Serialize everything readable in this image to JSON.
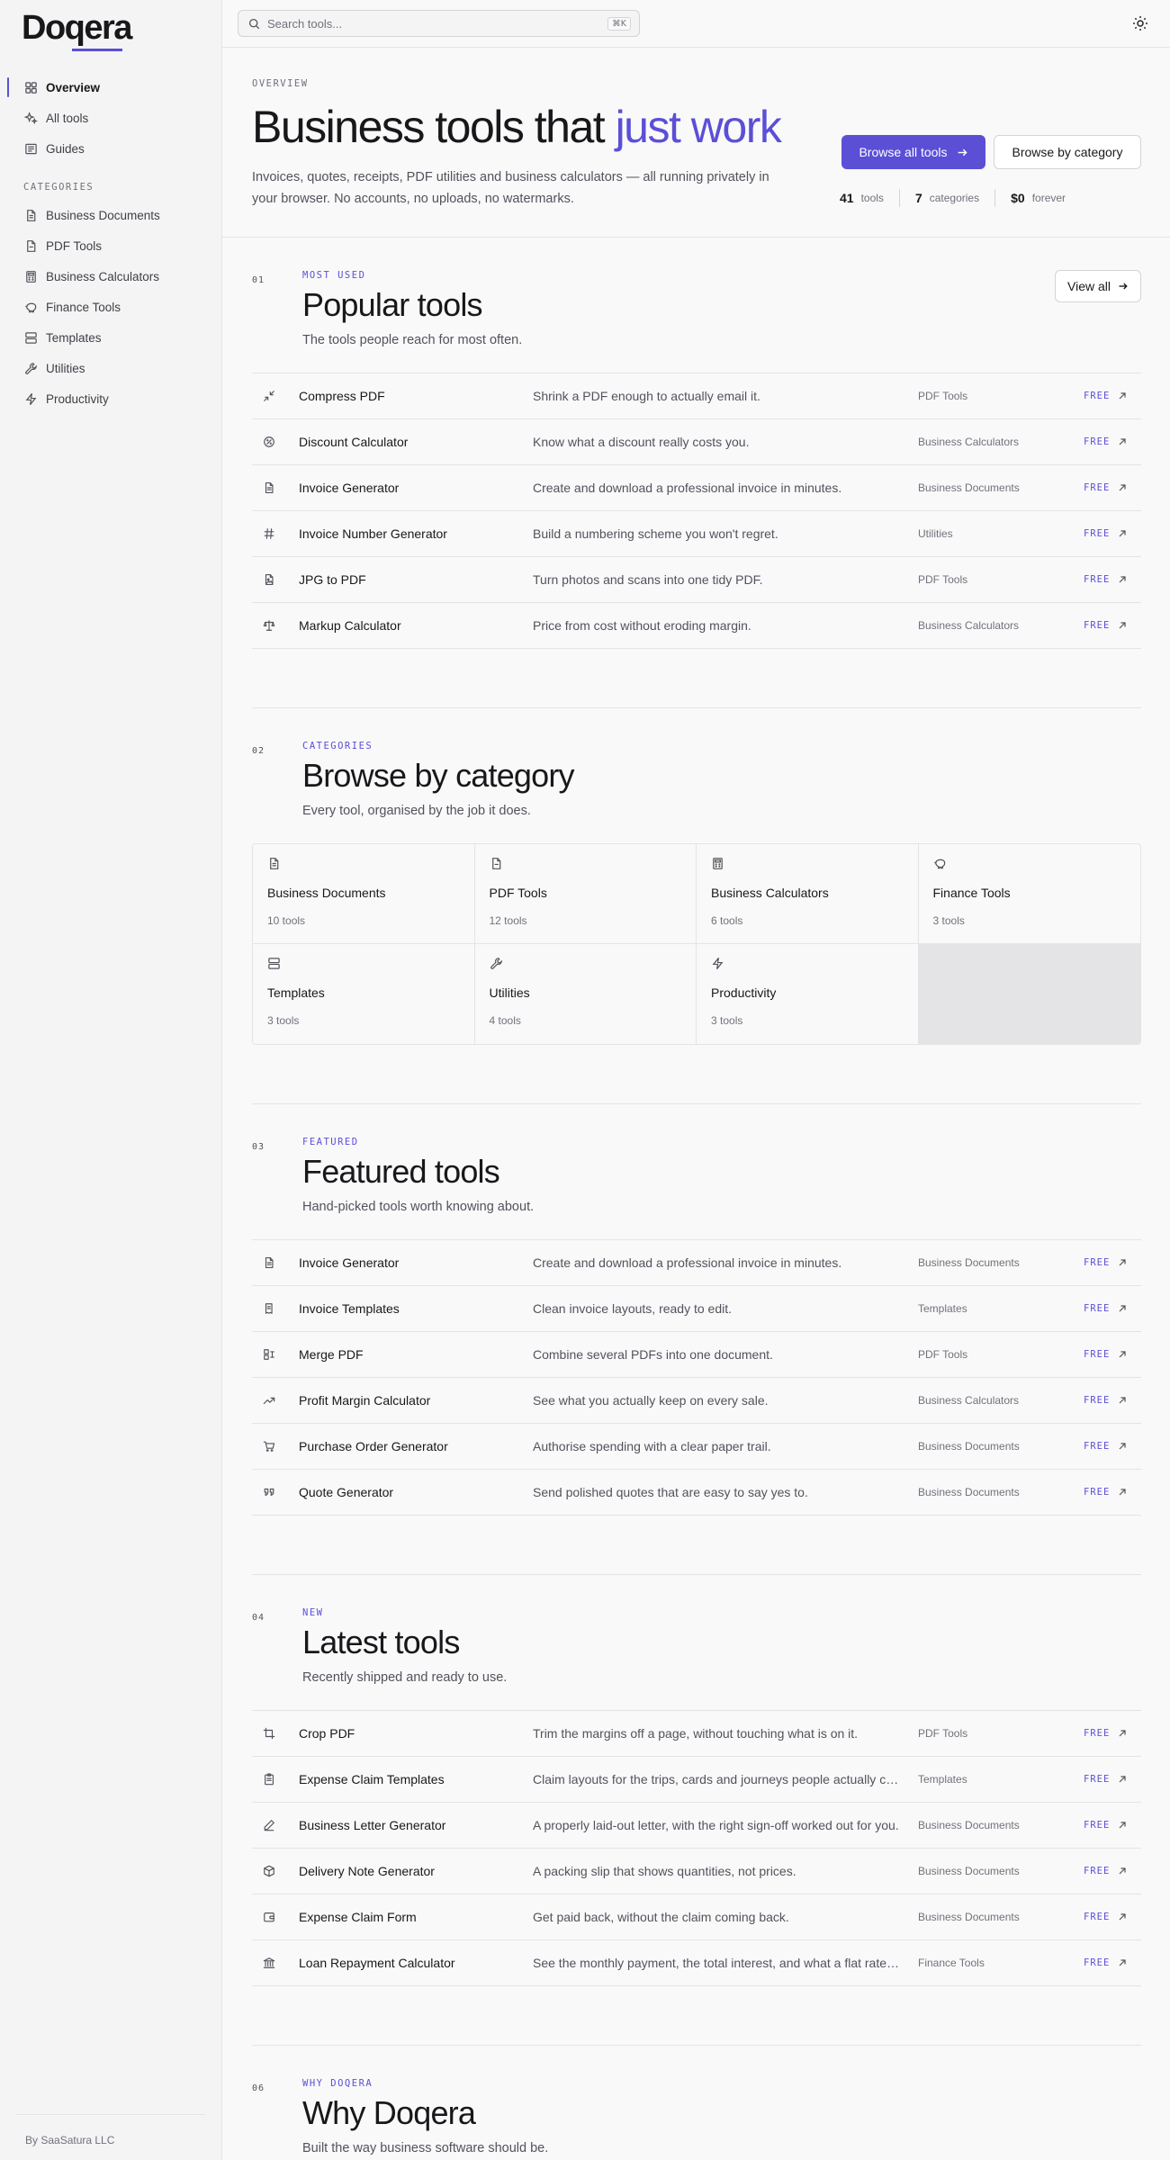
{
  "brand": {
    "logo": "Doqera",
    "footer": "By SaaSatura LLC"
  },
  "sidebar": {
    "items": [
      {
        "label": "Overview",
        "icon": "grid-icon"
      },
      {
        "label": "All tools",
        "icon": "sparkles-icon"
      },
      {
        "label": "Guides",
        "icon": "newspaper-icon"
      }
    ],
    "categories_label": "CATEGORIES",
    "categories": [
      {
        "label": "Business Documents",
        "icon": "document-icon"
      },
      {
        "label": "PDF Tools",
        "icon": "file-icon"
      },
      {
        "label": "Business Calculators",
        "icon": "calculator-icon"
      },
      {
        "label": "Finance Tools",
        "icon": "piggy-bank-icon"
      },
      {
        "label": "Templates",
        "icon": "layout-icon"
      },
      {
        "label": "Utilities",
        "icon": "wrench-icon"
      },
      {
        "label": "Productivity",
        "icon": "zap-icon"
      }
    ]
  },
  "search": {
    "placeholder": "Search tools...",
    "shortcut": "⌘K"
  },
  "hero": {
    "eyebrow": "OVERVIEW",
    "title_main": "Business tools that ",
    "title_accent": "just work",
    "subtitle": "Invoices, quotes, receipts, PDF utilities and business calculators — all running privately in your browser. No accounts, no uploads, no watermarks.",
    "primary_button": "Browse all tools",
    "secondary_button": "Browse by category",
    "stats": [
      {
        "num": "41",
        "label": "tools"
      },
      {
        "num": "7",
        "label": "categories"
      },
      {
        "num": "$0",
        "label": "forever"
      }
    ]
  },
  "popular": {
    "num": "01",
    "eyebrow": "MOST USED",
    "title": "Popular tools",
    "desc": "The tools people reach for most often.",
    "view_all": "View all",
    "tools": [
      {
        "name": "Compress PDF",
        "desc": "Shrink a PDF enough to actually email it.",
        "cat": "PDF Tools",
        "badge": "FREE"
      },
      {
        "name": "Discount Calculator",
        "desc": "Know what a discount really costs you.",
        "cat": "Business Calculators",
        "badge": "FREE"
      },
      {
        "name": "Invoice Generator",
        "desc": "Create and download a professional invoice in minutes.",
        "cat": "Business Documents",
        "badge": "FREE"
      },
      {
        "name": "Invoice Number Generator",
        "desc": "Build a numbering scheme you won't regret.",
        "cat": "Utilities",
        "badge": "FREE"
      },
      {
        "name": "JPG to PDF",
        "desc": "Turn photos and scans into one tidy PDF.",
        "cat": "PDF Tools",
        "badge": "FREE"
      },
      {
        "name": "Markup Calculator",
        "desc": "Price from cost without eroding margin.",
        "cat": "Business Calculators",
        "badge": "FREE"
      }
    ]
  },
  "categories": {
    "num": "02",
    "eyebrow": "CATEGORIES",
    "title": "Browse by category",
    "desc": "Every tool, organised by the job it does.",
    "items": [
      {
        "name": "Business Documents",
        "count": "10 tools"
      },
      {
        "name": "PDF Tools",
        "count": "12 tools"
      },
      {
        "name": "Business Calculators",
        "count": "6 tools"
      },
      {
        "name": "Finance Tools",
        "count": "3 tools"
      },
      {
        "name": "Templates",
        "count": "3 tools"
      },
      {
        "name": "Utilities",
        "count": "4 tools"
      },
      {
        "name": "Productivity",
        "count": "3 tools"
      }
    ]
  },
  "featured": {
    "num": "03",
    "eyebrow": "FEATURED",
    "title": "Featured tools",
    "desc": "Hand-picked tools worth knowing about.",
    "tools": [
      {
        "name": "Invoice Generator",
        "desc": "Create and download a professional invoice in minutes.",
        "cat": "Business Documents",
        "badge": "FREE"
      },
      {
        "name": "Invoice Templates",
        "desc": "Clean invoice layouts, ready to edit.",
        "cat": "Templates",
        "badge": "FREE"
      },
      {
        "name": "Merge PDF",
        "desc": "Combine several PDFs into one document.",
        "cat": "PDF Tools",
        "badge": "FREE"
      },
      {
        "name": "Profit Margin Calculator",
        "desc": "See what you actually keep on every sale.",
        "cat": "Business Calculators",
        "badge": "FREE"
      },
      {
        "name": "Purchase Order Generator",
        "desc": "Authorise spending with a clear paper trail.",
        "cat": "Business Documents",
        "badge": "FREE"
      },
      {
        "name": "Quote Generator",
        "desc": "Send polished quotes that are easy to say yes to.",
        "cat": "Business Documents",
        "badge": "FREE"
      }
    ]
  },
  "latest": {
    "num": "04",
    "eyebrow": "NEW",
    "title": "Latest tools",
    "desc": "Recently shipped and ready to use.",
    "tools": [
      {
        "name": "Crop PDF",
        "desc": "Trim the margins off a page, without touching what is on it.",
        "cat": "PDF Tools",
        "badge": "FREE"
      },
      {
        "name": "Expense Claim Templates",
        "desc": "Claim layouts for the trips, cards and journeys people actually claim.",
        "cat": "Templates",
        "badge": "FREE"
      },
      {
        "name": "Business Letter Generator",
        "desc": "A properly laid-out letter, with the right sign-off worked out for you.",
        "cat": "Business Documents",
        "badge": "FREE"
      },
      {
        "name": "Delivery Note Generator",
        "desc": "A packing slip that shows quantities, not prices.",
        "cat": "Business Documents",
        "badge": "FREE"
      },
      {
        "name": "Expense Claim Form",
        "desc": "Get paid back, without the claim coming back.",
        "cat": "Business Documents",
        "badge": "FREE"
      },
      {
        "name": "Loan Repayment Calculator",
        "desc": "See the monthly payment, the total interest, and what a flat rate really costs.",
        "cat": "Finance Tools",
        "badge": "FREE"
      }
    ]
  },
  "why": {
    "num": "06",
    "eyebrow": "WHY DOQERA",
    "title": "Why Doqera",
    "desc": "Built the way business software should be."
  }
}
